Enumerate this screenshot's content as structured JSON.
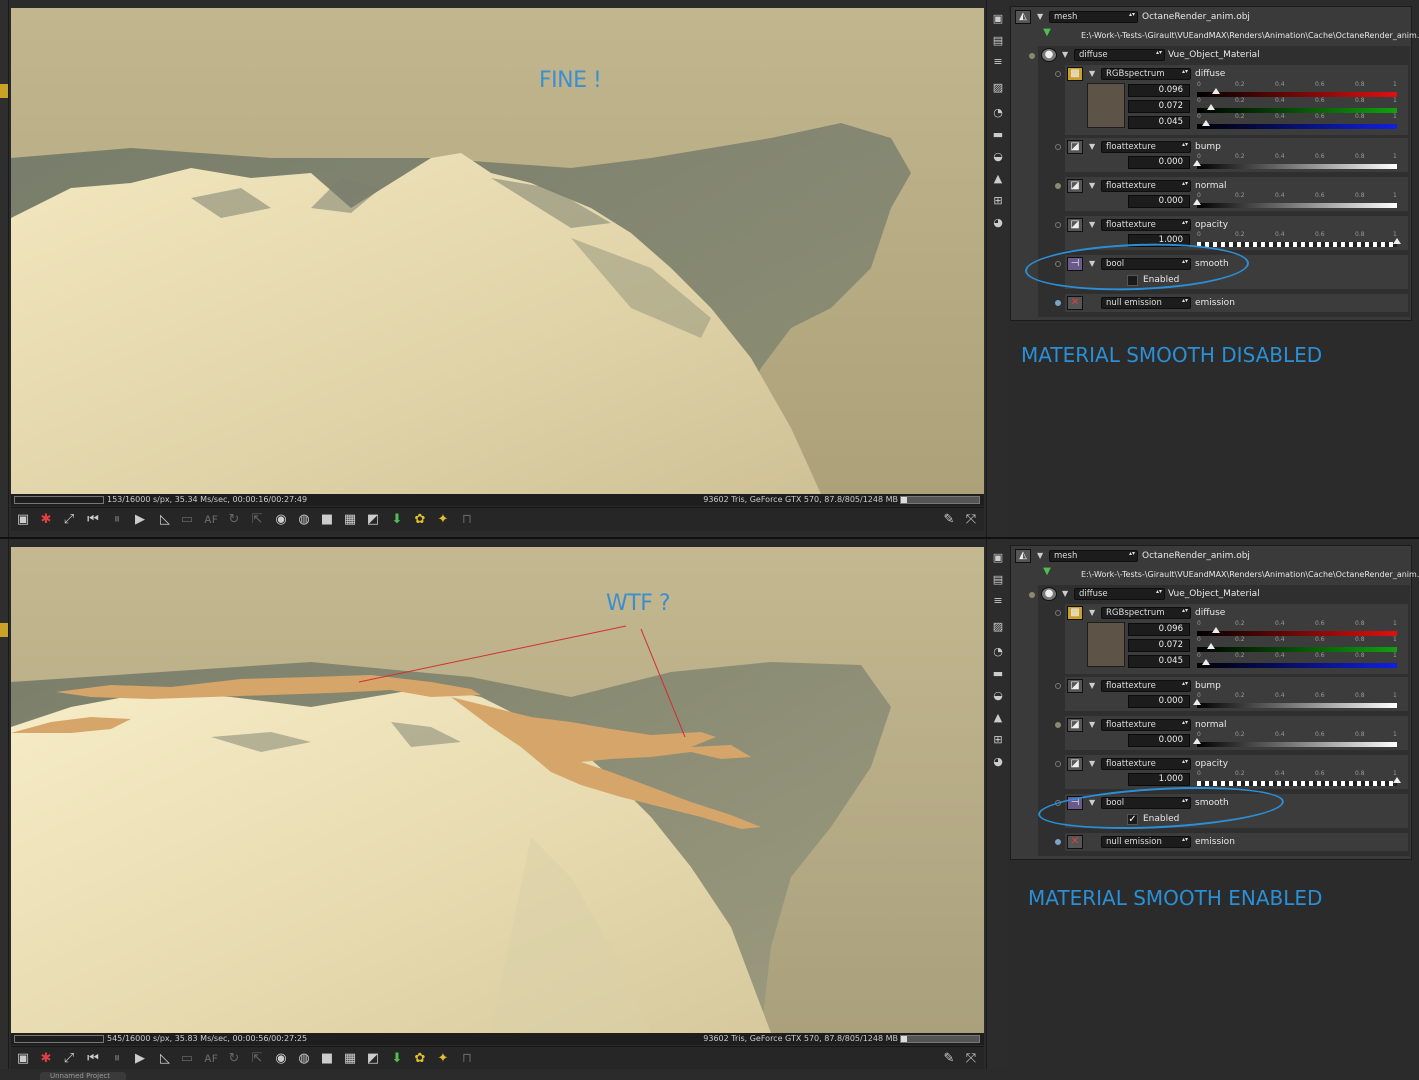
{
  "top": {
    "annotation": "FINE !",
    "side_note": "MATERIAL SMOOTH DISABLED",
    "status_left": "153/16000 s/px, 35.34 Ms/sec, 00:00:16/00:27:49",
    "status_right": "93602 Tris, GeForce GTX 570, 87.8/805/1248 MB",
    "smooth_checked": ""
  },
  "bottom": {
    "annotation": "WTF ?",
    "side_note": "MATERIAL SMOOTH ENABLED",
    "status_left": "545/16000 s/px, 35.83 Ms/sec, 00:00:56/00:27:25",
    "status_right": "93602 Tris, GeForce GTX 570, 87.8/805/1248 MB",
    "smooth_checked": "✓"
  },
  "panel": {
    "mesh_type": "mesh",
    "mesh_name": "OctaneRender_anim.obj",
    "mesh_path": "E:\\-Work-\\-Tests-\\Girault\\VUEandMAX\\Renders\\Animation\\Cache\\OctaneRender_anim.obj",
    "material_type": "diffuse",
    "material_name": "Vue_Object_Material",
    "diffuse": {
      "type": "RGBspectrum",
      "label": "diffuse",
      "r": "0.096",
      "g": "0.072",
      "b": "0.045",
      "swatch": "#5d5347"
    },
    "bump": {
      "type": "floattexture",
      "label": "bump",
      "value": "0.000"
    },
    "normal": {
      "type": "floattexture",
      "label": "normal",
      "value": "0.000"
    },
    "opacity": {
      "type": "floattexture",
      "label": "opacity",
      "value": "1.000"
    },
    "smooth": {
      "type": "bool",
      "label": "smooth",
      "checkbox_label": "Enabled"
    },
    "emission": {
      "type": "null emission",
      "label": "emission"
    },
    "ticks": [
      "0",
      "0.2",
      "0.4",
      "0.6",
      "0.8",
      "1"
    ]
  },
  "project_tab": "Unnamed Project",
  "colors": {
    "annotation_blue": "#2b8fd6",
    "red_line": "#d03030",
    "swatch": "#5d5347"
  }
}
